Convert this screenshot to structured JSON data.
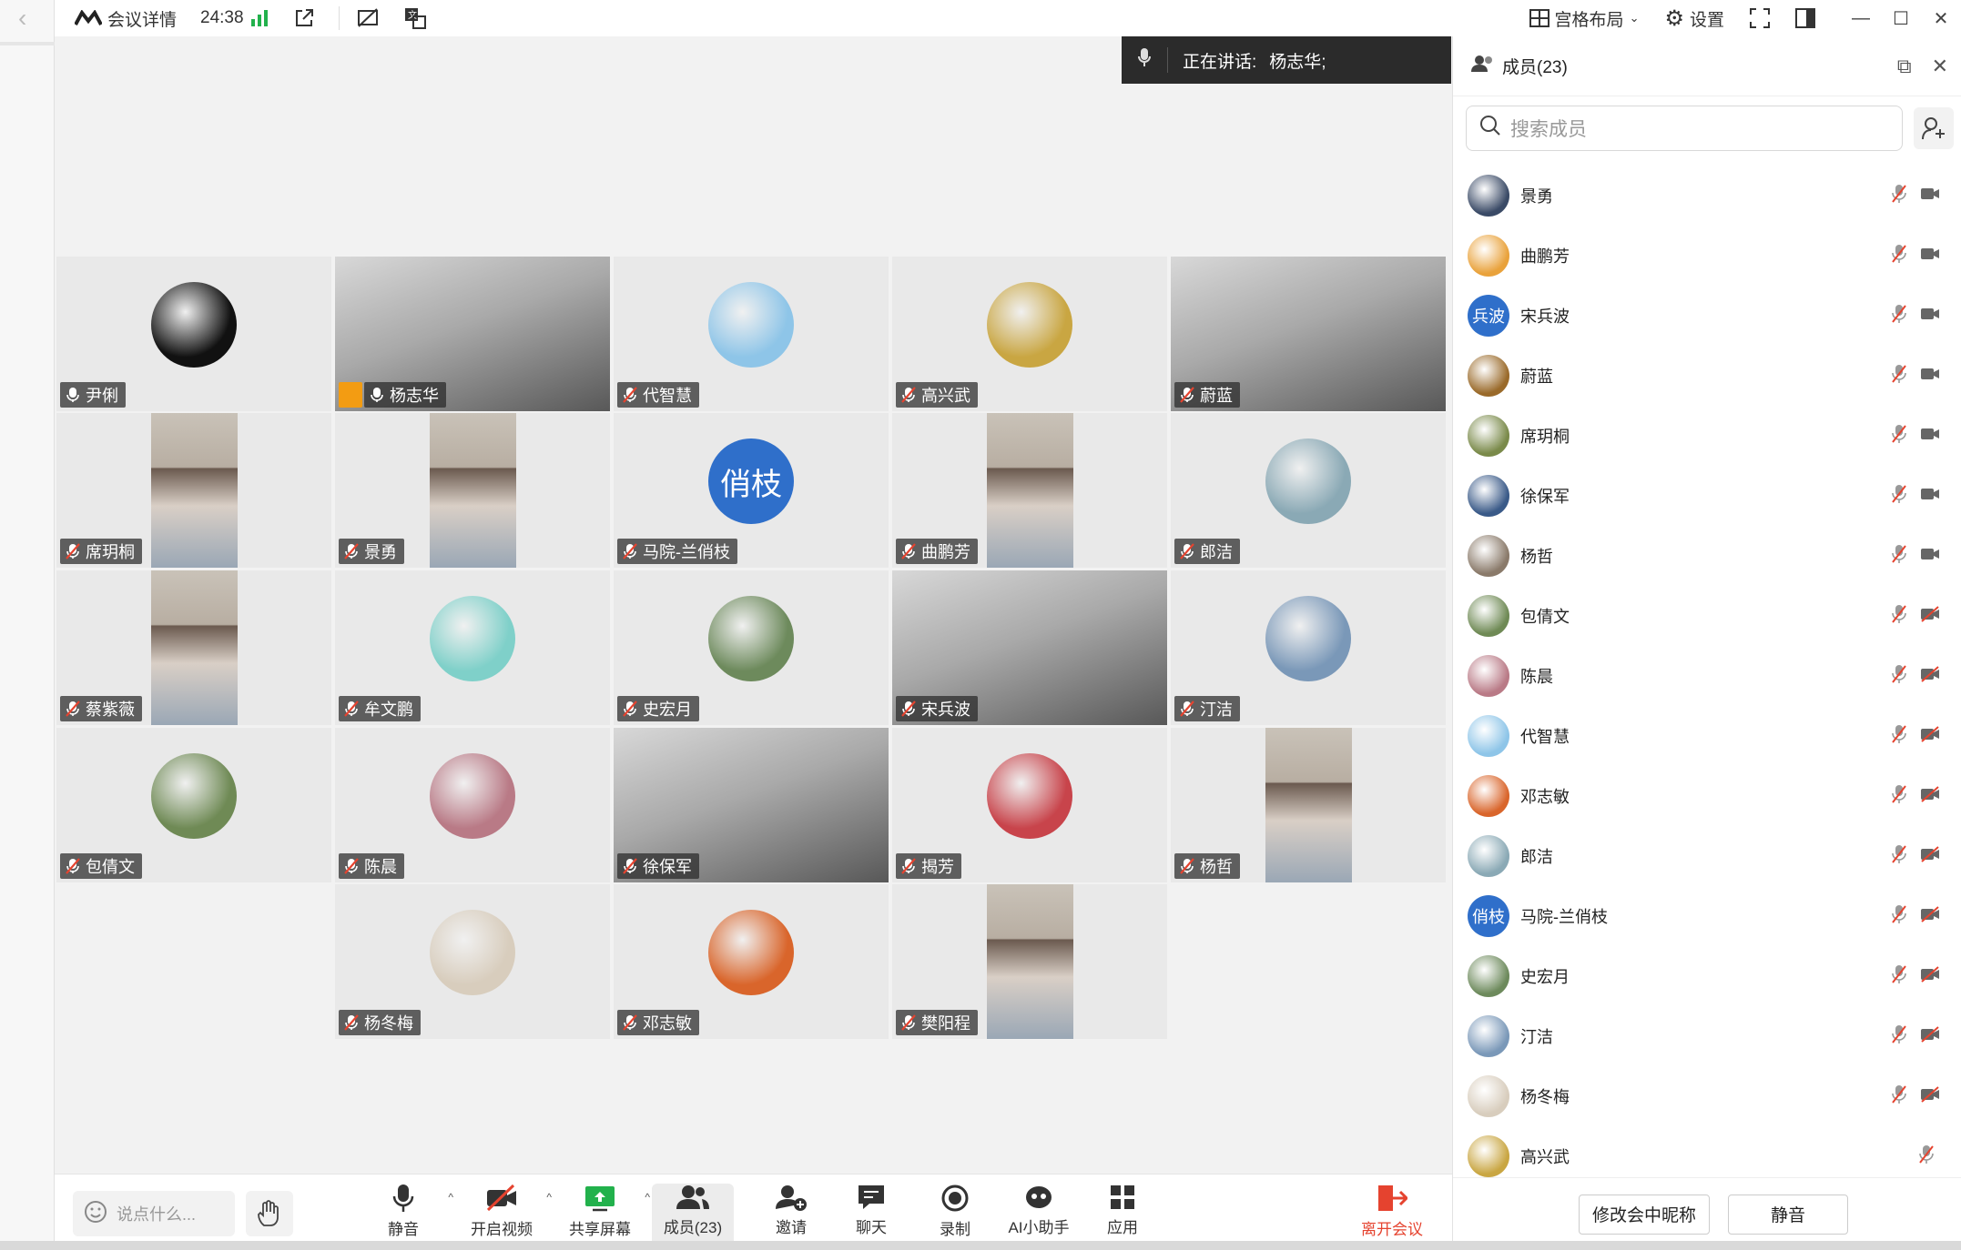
{
  "titlebar": {
    "meeting_details": "会议详情",
    "duration": "24:38",
    "layout_label": "宫格布局",
    "settings_label": "设置"
  },
  "speaking": {
    "prefix": "正在讲话:",
    "name": "杨志华;"
  },
  "tiles": [
    {
      "name": "尹俐",
      "mic": "on",
      "kind": "avatar",
      "color": "#111111"
    },
    {
      "name": "杨志华",
      "mic": "on",
      "kind": "video",
      "host": true,
      "active": true
    },
    {
      "name": "代智慧",
      "mic": "muted",
      "kind": "avatar",
      "color": "#8ec5e8"
    },
    {
      "name": "高兴武",
      "mic": "muted",
      "kind": "avatar",
      "color": "#c9a642"
    },
    {
      "name": "蔚蓝",
      "mic": "muted",
      "kind": "video"
    },
    {
      "name": "席玥桐",
      "mic": "muted",
      "kind": "portrait"
    },
    {
      "name": "景勇",
      "mic": "muted",
      "kind": "portrait"
    },
    {
      "name": "马院-兰俏枝",
      "mic": "muted",
      "kind": "text-avatar",
      "avatar_text": "俏枝",
      "color": "#2f6fca"
    },
    {
      "name": "曲鹏芳",
      "mic": "muted",
      "kind": "portrait"
    },
    {
      "name": "郎洁",
      "mic": "muted",
      "kind": "avatar",
      "color": "#8aa9b5"
    },
    {
      "name": "蔡紫薇",
      "mic": "muted",
      "kind": "portrait"
    },
    {
      "name": "牟文鹏",
      "mic": "muted",
      "kind": "avatar",
      "color": "#7fd0c9"
    },
    {
      "name": "史宏月",
      "mic": "muted",
      "kind": "avatar",
      "color": "#6d8a5c"
    },
    {
      "name": "宋兵波",
      "mic": "muted",
      "kind": "video"
    },
    {
      "name": "汀洁",
      "mic": "muted",
      "kind": "avatar",
      "color": "#7a98b8"
    },
    {
      "name": "包倩文",
      "mic": "muted",
      "kind": "avatar",
      "color": "#6f8a55"
    },
    {
      "name": "陈晨",
      "mic": "muted",
      "kind": "avatar",
      "color": "#b97a86"
    },
    {
      "name": "徐保军",
      "mic": "muted",
      "kind": "video"
    },
    {
      "name": "揭芳",
      "mic": "muted",
      "kind": "avatar",
      "color": "#c8444b"
    },
    {
      "name": "杨哲",
      "mic": "muted",
      "kind": "portrait"
    },
    {
      "name": "杨冬梅",
      "mic": "muted",
      "kind": "avatar",
      "color": "#d8cdbd"
    },
    {
      "name": "邓志敏",
      "mic": "muted",
      "kind": "avatar",
      "color": "#d9652b"
    },
    {
      "name": "樊阳程",
      "mic": "muted",
      "kind": "portrait"
    }
  ],
  "panel": {
    "title": "成员(23)",
    "search_placeholder": "搜索成员",
    "members": [
      {
        "name": "景勇",
        "color": "#3a4a66",
        "video": "on"
      },
      {
        "name": "曲鹏芳",
        "color": "#e9a23b",
        "video": "on"
      },
      {
        "name": "宋兵波",
        "color": "#2f6fca",
        "text": "兵波",
        "video": "on"
      },
      {
        "name": "蔚蓝",
        "color": "#9a6a2a",
        "video": "on"
      },
      {
        "name": "席玥桐",
        "color": "#7a8a4a",
        "video": "on"
      },
      {
        "name": "徐保军",
        "color": "#3a5a88",
        "video": "on"
      },
      {
        "name": "杨哲",
        "color": "#8a7a6a",
        "video": "on"
      },
      {
        "name": "包倩文",
        "color": "#6f8a55",
        "video": "off"
      },
      {
        "name": "陈晨",
        "color": "#b97a86",
        "video": "off"
      },
      {
        "name": "代智慧",
        "color": "#8ec5e8",
        "video": "off"
      },
      {
        "name": "邓志敏",
        "color": "#d9652b",
        "video": "off"
      },
      {
        "name": "郎洁",
        "color": "#8aa9b5",
        "video": "off"
      },
      {
        "name": "马院-兰俏枝",
        "color": "#2f6fca",
        "text": "俏枝",
        "video": "off"
      },
      {
        "name": "史宏月",
        "color": "#6d8a5c",
        "video": "off"
      },
      {
        "name": "汀洁",
        "color": "#7a98b8",
        "video": "off"
      },
      {
        "name": "杨冬梅",
        "color": "#d8cdbd",
        "video": "off"
      },
      {
        "name": "高兴武",
        "color": "#c9a642",
        "video": "none"
      }
    ],
    "rename_label": "修改会中昵称",
    "mute_label": "静音"
  },
  "toolbar": {
    "chat_placeholder": "说点什么...",
    "mute": "静音",
    "video": "开启视频",
    "share": "共享屏幕",
    "members": "成员(23)",
    "invite": "邀请",
    "chat": "聊天",
    "record": "录制",
    "ai": "AI小助手",
    "apps": "应用",
    "leave": "离开会议"
  }
}
